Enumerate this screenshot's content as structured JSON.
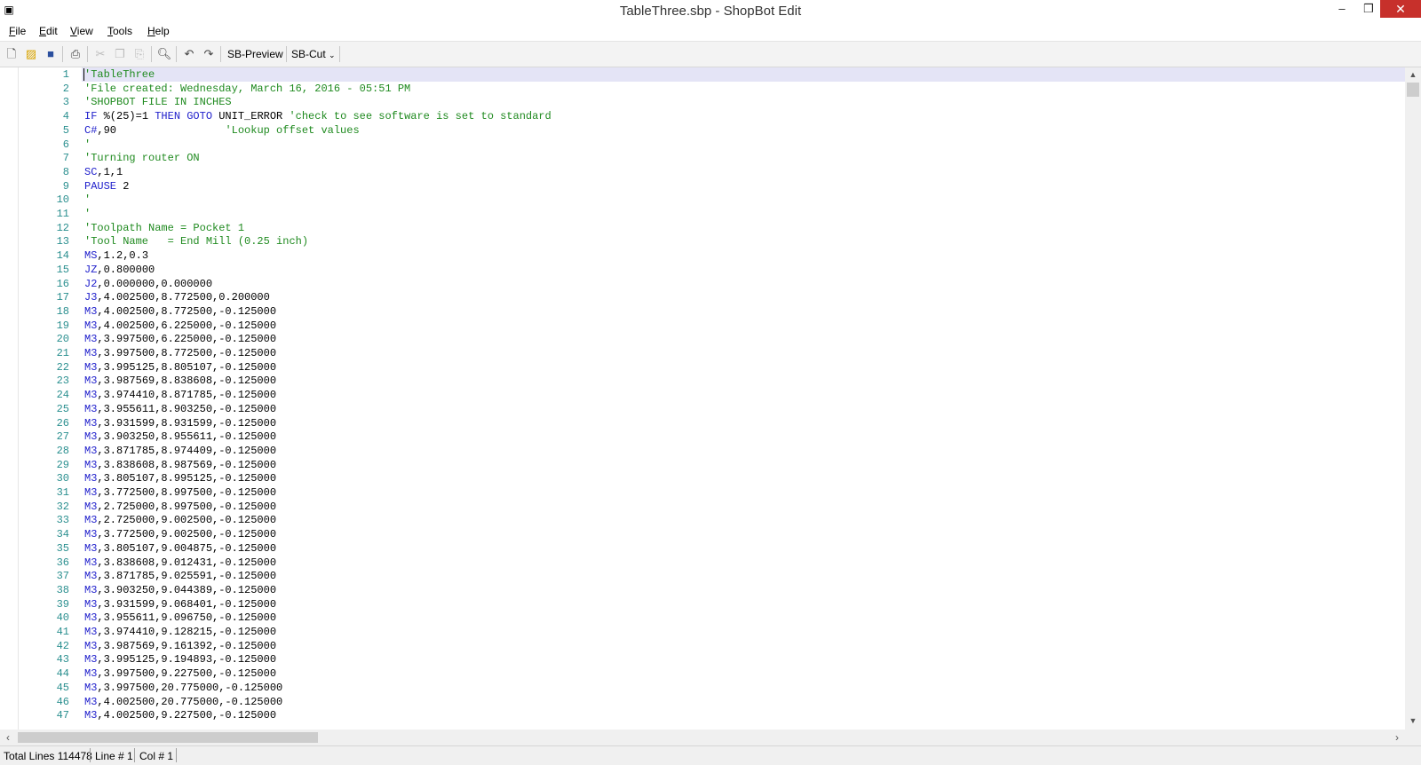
{
  "window": {
    "title": "TableThree.sbp - ShopBot Edit",
    "app_icon": "shopbot-app-icon",
    "controls": {
      "minimize": "–",
      "maximize": "❒",
      "close": "✕"
    }
  },
  "menu": [
    {
      "key": "F",
      "rest": "ile"
    },
    {
      "key": "E",
      "rest": "dit"
    },
    {
      "key": "V",
      "rest": "iew"
    },
    {
      "key": "T",
      "rest": "ools"
    },
    {
      "key": "H",
      "rest": "elp"
    }
  ],
  "toolbar": {
    "icons": [
      "new-file-icon",
      "open-folder-icon",
      "save-icon",
      "print-icon",
      "cut-icon",
      "copy-icon",
      "paste-icon",
      "find-icon",
      "undo-icon",
      "redo-icon"
    ],
    "sb_preview": "SB-Preview",
    "sb_cut": "SB-Cut",
    "dropdown_caret": "⌄"
  },
  "colors": {
    "command": "#2222cc",
    "comment": "#1f8a1f",
    "line_number": "#2a8f8f",
    "current_line": "#e4e4f6"
  },
  "editor": {
    "lines": [
      {
        "n": "1",
        "segs": [
          [
            "c",
            "'TableThree"
          ]
        ]
      },
      {
        "n": "2",
        "segs": [
          [
            "c",
            "'File created: Wednesday, March 16, 2016 - 05:51 PM"
          ]
        ]
      },
      {
        "n": "3",
        "segs": [
          [
            "c",
            "'SHOPBOT FILE IN INCHES"
          ]
        ]
      },
      {
        "n": "4",
        "segs": [
          [
            "k",
            "IF "
          ],
          [
            "t",
            "%(25)=1 "
          ],
          [
            "k",
            "THEN GOTO "
          ],
          [
            "t",
            "UNIT_ERROR "
          ],
          [
            "c",
            "'check to see software is set to standard"
          ]
        ]
      },
      {
        "n": "5",
        "segs": [
          [
            "k",
            "C#"
          ],
          [
            "t",
            ",90                 "
          ],
          [
            "c",
            "'Lookup offset values"
          ]
        ]
      },
      {
        "n": "6",
        "segs": [
          [
            "c",
            "'"
          ]
        ]
      },
      {
        "n": "7",
        "segs": [
          [
            "c",
            "'Turning router ON"
          ]
        ]
      },
      {
        "n": "8",
        "segs": [
          [
            "k",
            "SC"
          ],
          [
            "t",
            ",1,1"
          ]
        ]
      },
      {
        "n": "9",
        "segs": [
          [
            "k",
            "PAUSE "
          ],
          [
            "t",
            "2"
          ]
        ]
      },
      {
        "n": "10",
        "segs": [
          [
            "c",
            "'"
          ]
        ]
      },
      {
        "n": "11",
        "segs": [
          [
            "c",
            "'"
          ]
        ]
      },
      {
        "n": "12",
        "segs": [
          [
            "c",
            "'Toolpath Name = Pocket 1"
          ]
        ]
      },
      {
        "n": "13",
        "segs": [
          [
            "c",
            "'Tool Name   = End Mill (0.25 inch)"
          ]
        ]
      },
      {
        "n": "14",
        "segs": [
          [
            "k",
            "MS"
          ],
          [
            "t",
            ",1.2,0.3"
          ]
        ]
      },
      {
        "n": "15",
        "segs": [
          [
            "k",
            "JZ"
          ],
          [
            "t",
            ",0.800000"
          ]
        ]
      },
      {
        "n": "16",
        "segs": [
          [
            "k",
            "J2"
          ],
          [
            "t",
            ",0.000000,0.000000"
          ]
        ]
      },
      {
        "n": "17",
        "segs": [
          [
            "k",
            "J3"
          ],
          [
            "t",
            ",4.002500,8.772500,0.200000"
          ]
        ]
      },
      {
        "n": "18",
        "segs": [
          [
            "k",
            "M3"
          ],
          [
            "t",
            ",4.002500,8.772500,-0.125000"
          ]
        ]
      },
      {
        "n": "19",
        "segs": [
          [
            "k",
            "M3"
          ],
          [
            "t",
            ",4.002500,6.225000,-0.125000"
          ]
        ]
      },
      {
        "n": "20",
        "segs": [
          [
            "k",
            "M3"
          ],
          [
            "t",
            ",3.997500,6.225000,-0.125000"
          ]
        ]
      },
      {
        "n": "21",
        "segs": [
          [
            "k",
            "M3"
          ],
          [
            "t",
            ",3.997500,8.772500,-0.125000"
          ]
        ]
      },
      {
        "n": "22",
        "segs": [
          [
            "k",
            "M3"
          ],
          [
            "t",
            ",3.995125,8.805107,-0.125000"
          ]
        ]
      },
      {
        "n": "23",
        "segs": [
          [
            "k",
            "M3"
          ],
          [
            "t",
            ",3.987569,8.838608,-0.125000"
          ]
        ]
      },
      {
        "n": "24",
        "segs": [
          [
            "k",
            "M3"
          ],
          [
            "t",
            ",3.974410,8.871785,-0.125000"
          ]
        ]
      },
      {
        "n": "25",
        "segs": [
          [
            "k",
            "M3"
          ],
          [
            "t",
            ",3.955611,8.903250,-0.125000"
          ]
        ]
      },
      {
        "n": "26",
        "segs": [
          [
            "k",
            "M3"
          ],
          [
            "t",
            ",3.931599,8.931599,-0.125000"
          ]
        ]
      },
      {
        "n": "27",
        "segs": [
          [
            "k",
            "M3"
          ],
          [
            "t",
            ",3.903250,8.955611,-0.125000"
          ]
        ]
      },
      {
        "n": "28",
        "segs": [
          [
            "k",
            "M3"
          ],
          [
            "t",
            ",3.871785,8.974409,-0.125000"
          ]
        ]
      },
      {
        "n": "29",
        "segs": [
          [
            "k",
            "M3"
          ],
          [
            "t",
            ",3.838608,8.987569,-0.125000"
          ]
        ]
      },
      {
        "n": "30",
        "segs": [
          [
            "k",
            "M3"
          ],
          [
            "t",
            ",3.805107,8.995125,-0.125000"
          ]
        ]
      },
      {
        "n": "31",
        "segs": [
          [
            "k",
            "M3"
          ],
          [
            "t",
            ",3.772500,8.997500,-0.125000"
          ]
        ]
      },
      {
        "n": "32",
        "segs": [
          [
            "k",
            "M3"
          ],
          [
            "t",
            ",2.725000,8.997500,-0.125000"
          ]
        ]
      },
      {
        "n": "33",
        "segs": [
          [
            "k",
            "M3"
          ],
          [
            "t",
            ",2.725000,9.002500,-0.125000"
          ]
        ]
      },
      {
        "n": "34",
        "segs": [
          [
            "k",
            "M3"
          ],
          [
            "t",
            ",3.772500,9.002500,-0.125000"
          ]
        ]
      },
      {
        "n": "35",
        "segs": [
          [
            "k",
            "M3"
          ],
          [
            "t",
            ",3.805107,9.004875,-0.125000"
          ]
        ]
      },
      {
        "n": "36",
        "segs": [
          [
            "k",
            "M3"
          ],
          [
            "t",
            ",3.838608,9.012431,-0.125000"
          ]
        ]
      },
      {
        "n": "37",
        "segs": [
          [
            "k",
            "M3"
          ],
          [
            "t",
            ",3.871785,9.025591,-0.125000"
          ]
        ]
      },
      {
        "n": "38",
        "segs": [
          [
            "k",
            "M3"
          ],
          [
            "t",
            ",3.903250,9.044389,-0.125000"
          ]
        ]
      },
      {
        "n": "39",
        "segs": [
          [
            "k",
            "M3"
          ],
          [
            "t",
            ",3.931599,9.068401,-0.125000"
          ]
        ]
      },
      {
        "n": "40",
        "segs": [
          [
            "k",
            "M3"
          ],
          [
            "t",
            ",3.955611,9.096750,-0.125000"
          ]
        ]
      },
      {
        "n": "41",
        "segs": [
          [
            "k",
            "M3"
          ],
          [
            "t",
            ",3.974410,9.128215,-0.125000"
          ]
        ]
      },
      {
        "n": "42",
        "segs": [
          [
            "k",
            "M3"
          ],
          [
            "t",
            ",3.987569,9.161392,-0.125000"
          ]
        ]
      },
      {
        "n": "43",
        "segs": [
          [
            "k",
            "M3"
          ],
          [
            "t",
            ",3.995125,9.194893,-0.125000"
          ]
        ]
      },
      {
        "n": "44",
        "segs": [
          [
            "k",
            "M3"
          ],
          [
            "t",
            ",3.997500,9.227500,-0.125000"
          ]
        ]
      },
      {
        "n": "45",
        "segs": [
          [
            "k",
            "M3"
          ],
          [
            "t",
            ",3.997500,20.775000,-0.125000"
          ]
        ]
      },
      {
        "n": "46",
        "segs": [
          [
            "k",
            "M3"
          ],
          [
            "t",
            ",4.002500,20.775000,-0.125000"
          ]
        ]
      },
      {
        "n": "47",
        "segs": [
          [
            "k",
            "M3"
          ],
          [
            "t",
            ",4.002500,9.227500,-0.125000"
          ]
        ]
      }
    ]
  },
  "status": {
    "total_lines": "Total Lines 114478",
    "line": "Line # 1",
    "col": "Col # 1"
  }
}
